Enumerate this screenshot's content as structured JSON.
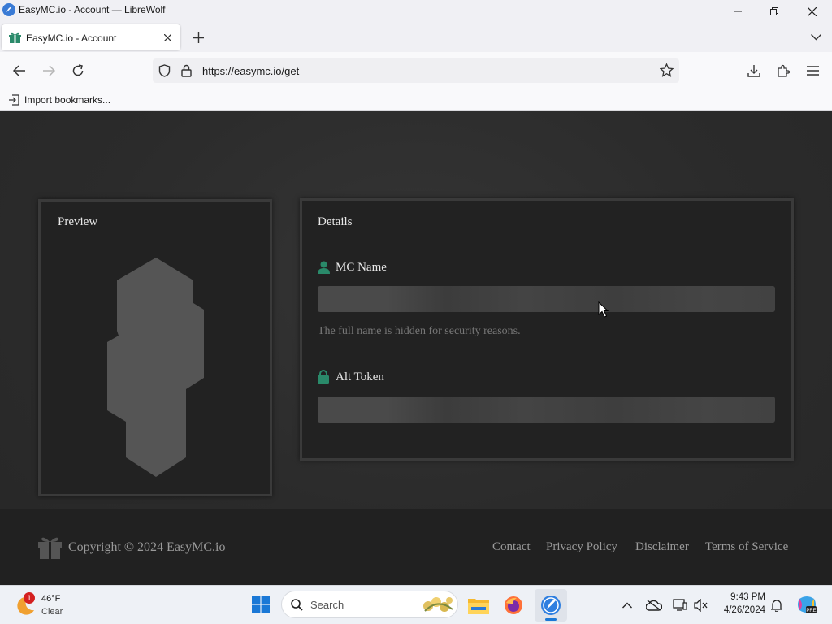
{
  "window": {
    "title": "EasyMC.io - Account — LibreWolf"
  },
  "tab": {
    "label": "EasyMC.io - Account"
  },
  "address": {
    "url": "https://easymc.io/get"
  },
  "bookmarks": {
    "import_label": "Import bookmarks..."
  },
  "page": {
    "preview_title": "Preview",
    "details_title": "Details",
    "mc_name_label": "MC Name",
    "mc_name_hint": "The full name is hidden for security reasons.",
    "alt_token_label": "Alt Token"
  },
  "footer": {
    "copyright": "Copyright © 2024 EasyMC.io",
    "links": [
      "Contact",
      "Privacy Policy",
      "Disclaimer",
      "Terms of Service"
    ]
  },
  "taskbar": {
    "weather_temp": "46°F",
    "weather_desc": "Clear",
    "weather_badge": "1",
    "search_placeholder": "Search",
    "time": "9:43 PM",
    "date": "4/26/2024"
  },
  "colors": {
    "accent_green": "#2a8a6a",
    "page_bg": "#2b2b2b",
    "panel_bg": "#222222"
  },
  "icons": [
    "librewolf-icon",
    "gift-icon",
    "minimize-icon",
    "maximize-icon",
    "close-icon",
    "back-icon",
    "forward-icon",
    "reload-icon",
    "shield-icon",
    "lock-icon",
    "star-icon",
    "download-icon",
    "extensions-icon",
    "menu-icon",
    "import-icon",
    "user-icon",
    "padlock-icon",
    "windows-start-icon",
    "search-icon",
    "file-explorer-icon",
    "firefox-icon",
    "librewolf-taskbar-icon",
    "chevron-up-icon",
    "onedrive-icon",
    "display-icon",
    "speaker-muted-icon",
    "bell-icon",
    "copilot-icon"
  ]
}
